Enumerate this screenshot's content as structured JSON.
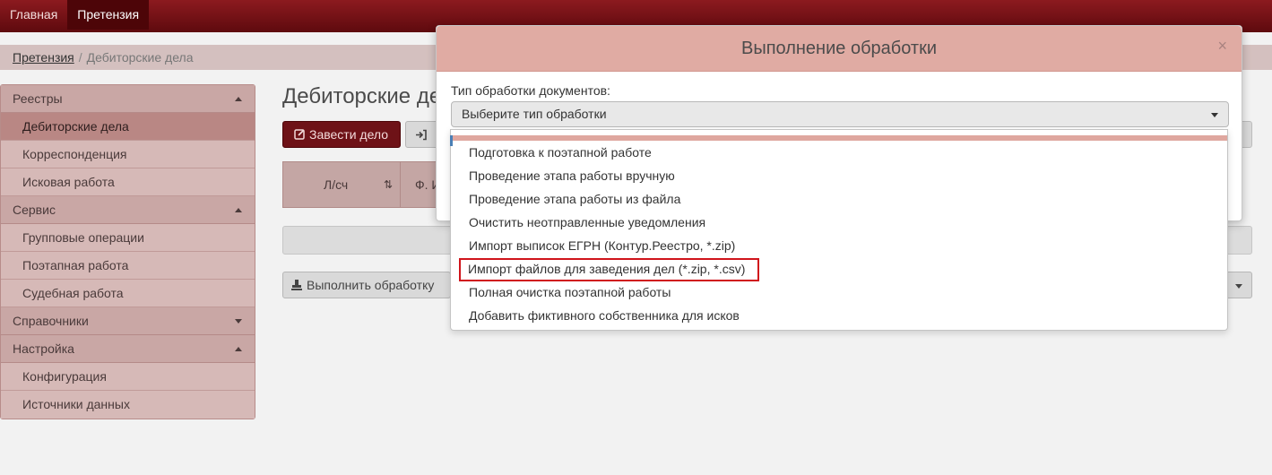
{
  "topnav": {
    "items": [
      "Главная",
      "Претензия"
    ]
  },
  "breadcrumb": {
    "link": "Претензия",
    "separator": "/",
    "current": "Дебиторские дела"
  },
  "sidebar": {
    "sections": [
      {
        "title": "Реестры",
        "items": [
          "Дебиторские дела",
          "Корреспонденция",
          "Исковая работа"
        ]
      },
      {
        "title": "Сервис",
        "items": [
          "Групповые операции",
          "Поэтапная работа",
          "Судебная работа"
        ]
      },
      {
        "title": "Справочники",
        "items": []
      },
      {
        "title": "Настройка",
        "items": [
          "Конфигурация",
          "Источники данных"
        ]
      }
    ]
  },
  "main": {
    "title": "Дебиторские де",
    "new_case_button": "Завести дело",
    "table": {
      "col1": "Л/сч",
      "col2": "Ф. И"
    },
    "exec_button": "Выполнить обработку"
  },
  "modal": {
    "title": "Выполнение обработки",
    "close": "×",
    "label": "Тип обработки документов:",
    "select_placeholder": "Выберите тип обработки",
    "options": [
      "Подготовка к поэтапной работе",
      "Проведение этапа работы вручную",
      "Проведение этапа работы из файла",
      "Очистить неотправленные уведомления",
      "Импорт выписок ЕГРН (Контур.Реестро, *.zip)",
      "Импорт файлов для заведения дел (*.zip, *.csv)",
      "Полная очистка поэтапной работы",
      "Добавить фиктивного собственника для исков"
    ],
    "highlighted_option_index": 5
  },
  "colors": {
    "nav_dark": "#5e0a0e",
    "accent": "#6e1217",
    "modal_header": "#e0aba3",
    "highlight_border": "#d0141b"
  }
}
